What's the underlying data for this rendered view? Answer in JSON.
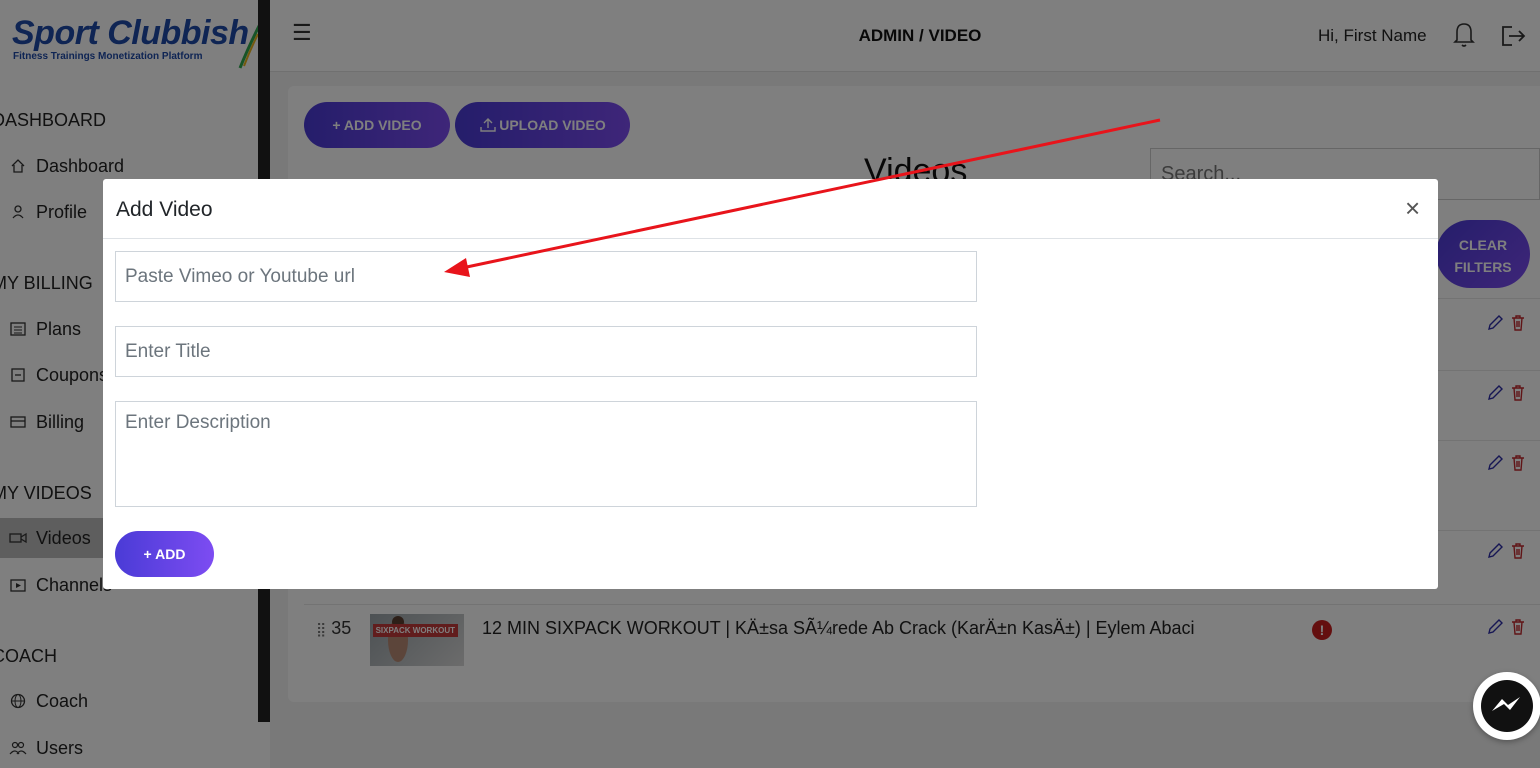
{
  "brand": {
    "name": "Sport Clubbish",
    "tagline": "Fitness Trainings Monetization Platform"
  },
  "sidebar": {
    "sections": [
      {
        "title": "DASHBOARD",
        "items": [
          {
            "label": "Dashboard",
            "icon": "home-icon"
          },
          {
            "label": "Profile",
            "icon": "user-icon"
          }
        ]
      },
      {
        "title": "MY BILLING",
        "items": [
          {
            "label": "Plans",
            "icon": "list-icon"
          },
          {
            "label": "Coupons",
            "icon": "coupon-icon"
          },
          {
            "label": "Billing",
            "icon": "card-icon"
          }
        ]
      },
      {
        "title": "MY VIDEOS",
        "items": [
          {
            "label": "Videos",
            "icon": "video-icon",
            "active": true
          },
          {
            "label": "Channels",
            "icon": "channel-icon"
          }
        ]
      },
      {
        "title": "COACH",
        "items": [
          {
            "label": "Coach",
            "icon": "globe-icon"
          },
          {
            "label": "Users",
            "icon": "users-icon"
          }
        ]
      }
    ]
  },
  "header": {
    "title": "ADMIN / VIDEO",
    "greeting": "Hi, First Name"
  },
  "main": {
    "add_video_label": "+ ADD VIDEO",
    "upload_video_label": "UPLOAD VIDEO",
    "heading": "Videos",
    "search_placeholder": "Search...",
    "clear_filters_line1": "CLEAR",
    "clear_filters_line2": "FILTERS",
    "visible_row": {
      "number": "35",
      "title": "12 MIN SIXPACK WORKOUT | KÄ±sa SÃ¼rede Ab Crack (KarÄ±n KasÄ±) | Eylem Abaci",
      "thumb_text": "SIXPACK WORKOUT",
      "status": "warning"
    }
  },
  "modal": {
    "title": "Add Video",
    "close_label": "×",
    "url_placeholder": "Paste Vimeo or Youtube url",
    "title_placeholder": "Enter Title",
    "description_placeholder": "Enter Description",
    "add_label": "+ ADD"
  },
  "colors": {
    "accent_start": "#4a3bd6",
    "accent_end": "#7d4cf2",
    "brand_blue": "#1f4aa8",
    "annotation_arrow": "#e8141b"
  }
}
